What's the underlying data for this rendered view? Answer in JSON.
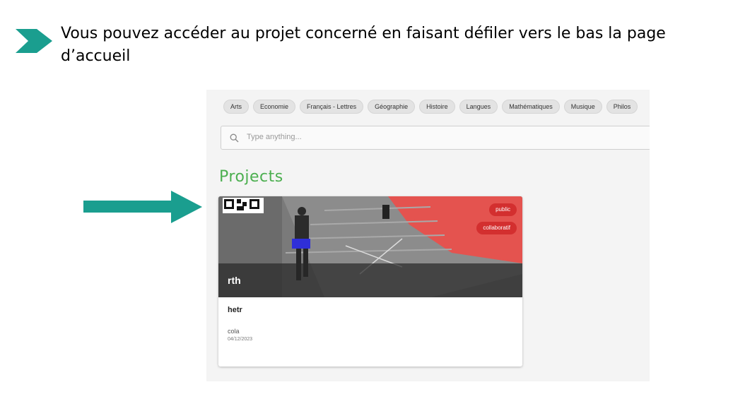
{
  "caption": {
    "text": "Vous pouvez accéder au projet concerné en faisant défiler vers le bas la page d’accueil",
    "bullet_icon": "chevron-right-icon",
    "bullet_color": "#1a9e8f"
  },
  "pointer": {
    "icon": "arrow-right-icon",
    "color": "#1a9e8f"
  },
  "app": {
    "categories": [
      "Arts",
      "Economie",
      "Français - Lettres",
      "Géographie",
      "Histoire",
      "Langues",
      "Mathématiques",
      "Musique",
      "Philos"
    ],
    "search": {
      "placeholder": "Type anything...",
      "value": "",
      "icon": "search-icon"
    },
    "section_title": "Projects",
    "section_title_color": "#4caf50",
    "project": {
      "title": "rth",
      "badges": [
        "public",
        "collaboratif"
      ],
      "badge_color": "#d32f2f",
      "subtitle": "hetr",
      "author": "cola",
      "date": "04/12/2023"
    }
  }
}
